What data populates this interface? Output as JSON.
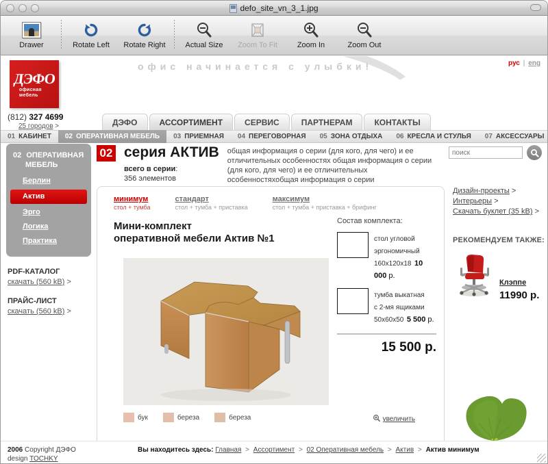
{
  "window": {
    "title": "defo_site_vn_3_1.jpg",
    "doc_icon": "jpeg-document-icon"
  },
  "toolbar": {
    "items": [
      {
        "label": "Drawer",
        "icon": "drawer-thumbnail-icon",
        "disabled": false
      },
      {
        "label": "Rotate Left",
        "icon": "rotate-left-icon",
        "disabled": false
      },
      {
        "label": "Rotate Right",
        "icon": "rotate-right-icon",
        "disabled": false
      },
      {
        "label": "Actual Size",
        "icon": "actual-size-icon",
        "disabled": false
      },
      {
        "label": "Zoom To Fit",
        "icon": "zoom-to-fit-icon",
        "disabled": true
      },
      {
        "label": "Zoom In",
        "icon": "zoom-in-icon",
        "disabled": false
      },
      {
        "label": "Zoom Out",
        "icon": "zoom-out-icon",
        "disabled": false
      }
    ]
  },
  "site": {
    "logo": {
      "mark": "ДЭФО",
      "sub1": "офисная",
      "sub2": "мебель"
    },
    "phone": {
      "code": "(812)",
      "number": "327 4699"
    },
    "cities": "25 городов",
    "cities_arrow": ">",
    "tagline": "офис начинается с улыбки!",
    "lang": {
      "ru": "рус",
      "sep": "|",
      "en": "eng"
    },
    "mainnav": [
      {
        "label": "ДЭФО",
        "active": false
      },
      {
        "label": "АССОРТИМЕНТ",
        "active": true
      },
      {
        "label": "СЕРВИС",
        "active": false
      },
      {
        "label": "ПАРТНЕРАМ",
        "active": false
      },
      {
        "label": "КОНТАКТЫ",
        "active": false
      }
    ],
    "subnav": [
      {
        "num": "01",
        "label": "КАБИНЕТ",
        "active": false
      },
      {
        "num": "02",
        "label": "ОПЕРАТИВНАЯ МЕБЕЛЬ",
        "active": true
      },
      {
        "num": "03",
        "label": "ПРИЕМНАЯ",
        "active": false
      },
      {
        "num": "04",
        "label": "ПЕРЕГОВОРНАЯ",
        "active": false
      },
      {
        "num": "05",
        "label": "ЗОНА ОТДЫХА",
        "active": false
      },
      {
        "num": "06",
        "label": "КРЕСЛА И СТУЛЬЯ",
        "active": false
      },
      {
        "num": "07",
        "label": "АКСЕССУАРЫ",
        "active": false
      }
    ],
    "sidebar": {
      "head_num": "02",
      "head_line1": "ОПЕРАТИВНАЯ",
      "head_line2": "МЕБЕЛЬ",
      "items": [
        {
          "label": "Берлин",
          "active": false
        },
        {
          "label": "Актив",
          "active": true
        },
        {
          "label": "Эрго",
          "active": false
        },
        {
          "label": "Логика",
          "active": false
        },
        {
          "label": "Практика",
          "active": false
        }
      ],
      "blocks": [
        {
          "title": "PDF-КАТАЛОГ",
          "link": "скачать (560 kB)",
          "arrow": ">"
        },
        {
          "title": "ПРАЙС-ЛИСТ",
          "link": "скачать (560 kB)",
          "arrow": ">"
        }
      ]
    },
    "search": {
      "placeholder": "поиск",
      "value": "",
      "button_icon": "search-icon"
    },
    "series": {
      "badge": "02",
      "title": "серия АКТИВ",
      "total_label": "всего в серии",
      "total_value": "356 элементов",
      "description": "общая информация о серии (для кого, для чего) и ее отличительных особенностях общая информация о серии (для кого, для чего) и ее отличительных особенностяхобщая информация о серии"
    },
    "variants": [
      {
        "title": "минимум",
        "detail": "стол + тумба",
        "active": true
      },
      {
        "title": "стандарт",
        "detail": "стол + тумба + приставка",
        "active": false
      },
      {
        "title": "максимум",
        "detail": "стол + тумба + приставка + брифинг",
        "active": false
      }
    ],
    "product": {
      "title_line1": "Мини-комплект",
      "title_line2": "оперативной мебели Актив №1",
      "image_alt": "corner-desk-photo"
    },
    "swatches": [
      {
        "label": "бук",
        "color": "#e7c0ad"
      },
      {
        "label": "береза",
        "color": "#e3beaa"
      },
      {
        "label": "береза",
        "color": "#e0bda9"
      }
    ],
    "zoom_link": {
      "label": "увеличить",
      "icon": "magnifier-plus-icon"
    },
    "composition": {
      "heading": "Состав комплекта:",
      "items": [
        {
          "name_line1": "стол угловой",
          "name_line2": "эргономичный",
          "dimensions": "160x120x18",
          "price": "10 000",
          "currency": "р."
        },
        {
          "name_line1": "тумба выкатная",
          "name_line2": "с 2-мя ящиками",
          "dimensions": "50x60x50",
          "price": "5 500",
          "currency": "р."
        }
      ],
      "total": "15 500 р."
    },
    "right_links": [
      {
        "label": "Дизайн-проекты",
        "arrow": ">"
      },
      {
        "label": "Интерьеры",
        "arrow": ">"
      },
      {
        "label": "Скачать буклет (35 kB)",
        "arrow": ">"
      }
    ],
    "recommend": {
      "heading": "РЕКОМЕНДУЕМ ТАКЖЕ:",
      "name": "Клэппе",
      "price": "11990 р.",
      "image_alt": "red-office-chair-photo"
    },
    "footer": {
      "copyright_year": "2006",
      "copyright_text": "Copyright ДЭФО",
      "design_label": "design",
      "design_link": "TOCHKY",
      "breadcrumb_label": "Вы находитесь здесь:",
      "breadcrumb": [
        {
          "label": "Главная",
          "link": true
        },
        {
          "label": "Ассортимент",
          "link": true
        },
        {
          "label": "02 Оперативная мебель",
          "link": true
        },
        {
          "label": "Актив",
          "link": true
        },
        {
          "label": "Актив минимум",
          "link": false
        }
      ],
      "separator": ">"
    },
    "colors": {
      "brand_red": "#cc0000",
      "sidebar_gray": "#a3a3a3",
      "accent_green": "#6a9a30"
    }
  }
}
